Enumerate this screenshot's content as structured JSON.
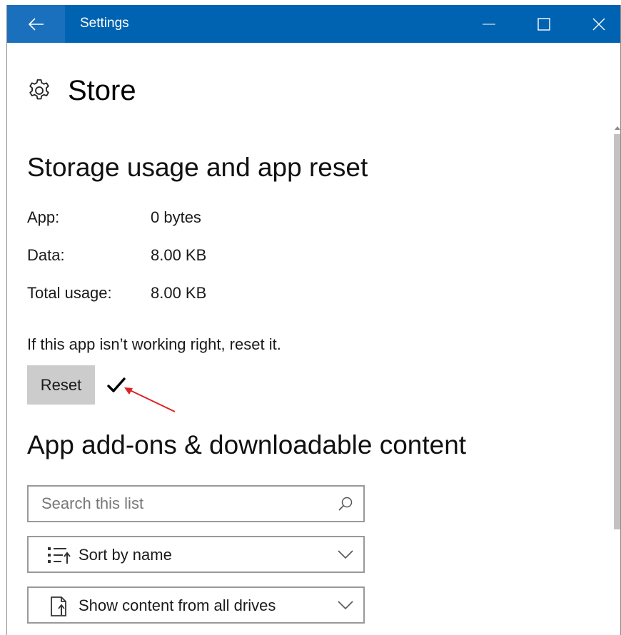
{
  "window": {
    "title": "Settings",
    "accent_color": "#0063b1"
  },
  "titlebar": {
    "back_icon": "arrow-left-icon",
    "minimize_icon": "minimize-icon",
    "maximize_icon": "maximize-icon",
    "close_icon": "close-icon"
  },
  "page": {
    "icon": "gear-icon",
    "title": "Store"
  },
  "storage": {
    "section_title": "Storage usage and app reset",
    "rows": [
      {
        "label": "App:",
        "value": "0 bytes"
      },
      {
        "label": "Data:",
        "value": "8.00 KB"
      },
      {
        "label": "Total usage:",
        "value": "8.00 KB"
      }
    ],
    "hint": "If this app isn’t working right, reset it.",
    "reset_label": "Reset",
    "reset_status_icon": "checkmark-icon",
    "annotation_color": "#e02020"
  },
  "addons": {
    "section_title": "App add-ons & downloadable content",
    "search_placeholder": "Search this list",
    "search_icon": "search-icon",
    "sort_label": "Sort by name",
    "sort_icon": "sort-list-icon",
    "drives_label": "Show content from all drives",
    "drives_icon": "drive-filter-icon"
  }
}
